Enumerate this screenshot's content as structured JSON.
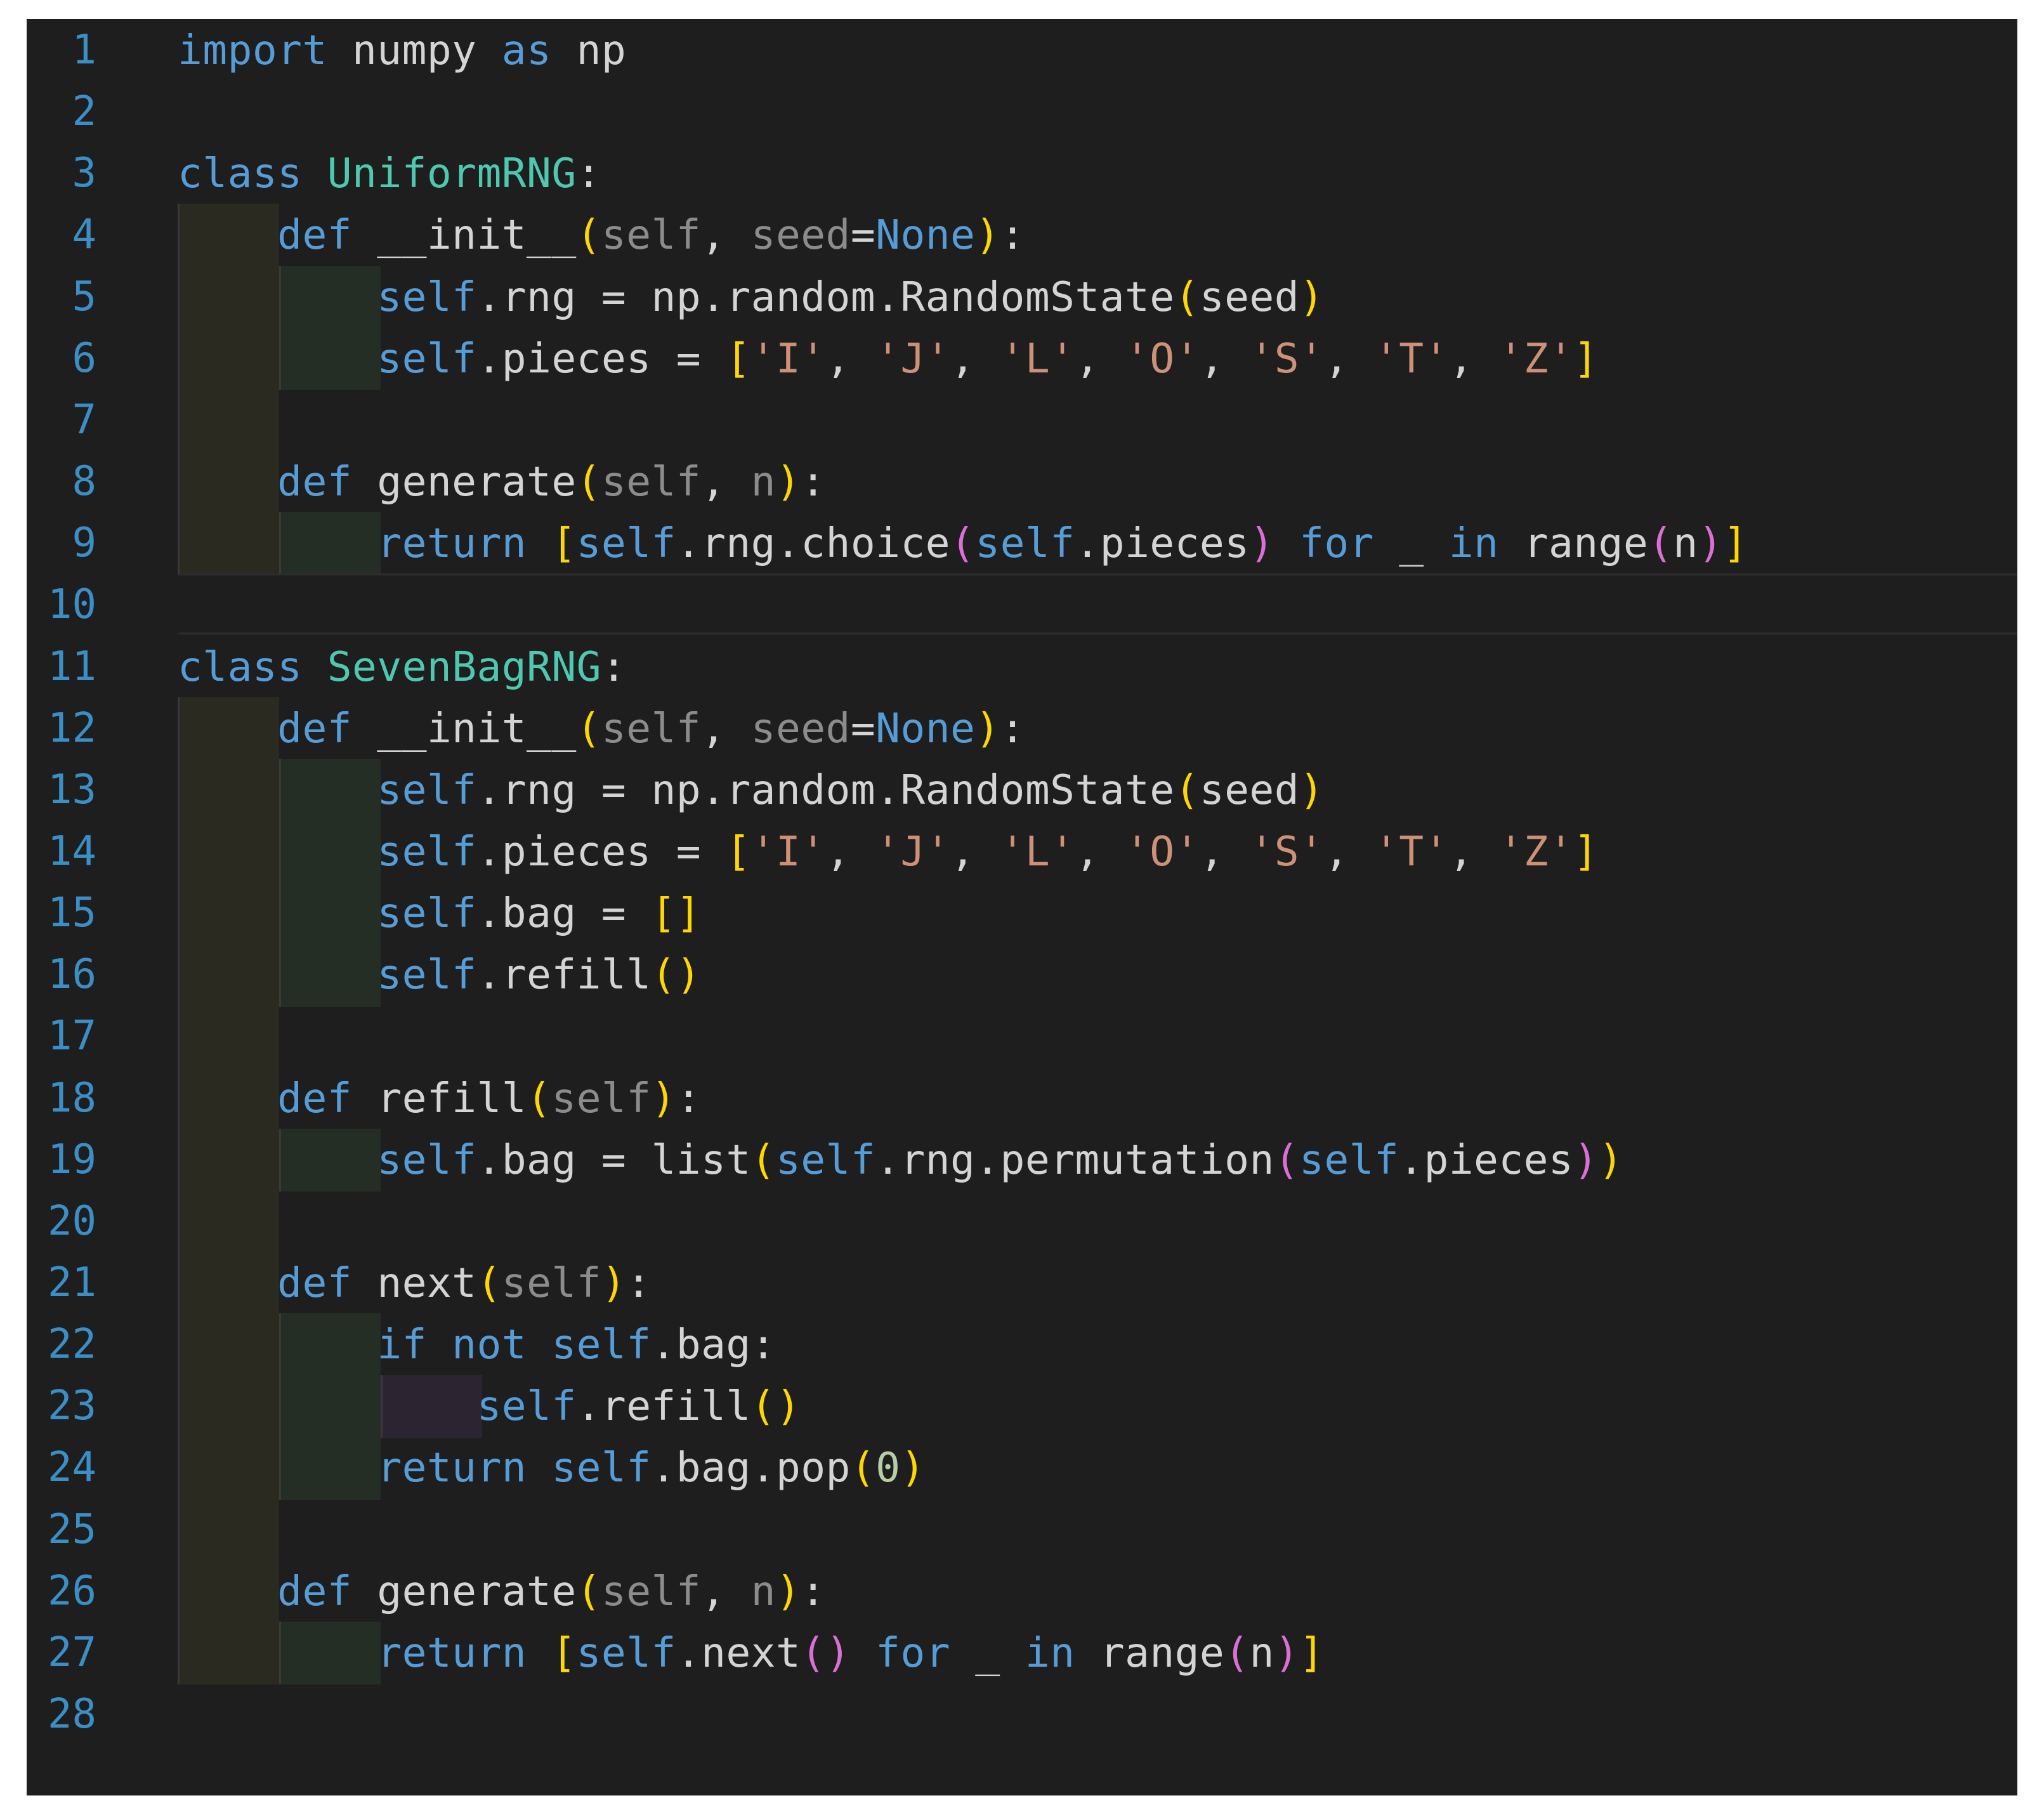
{
  "editor": {
    "line_numbers": [
      "1",
      "2",
      "3",
      "4",
      "5",
      "6",
      "7",
      "8",
      "9",
      "10",
      "11",
      "12",
      "13",
      "14",
      "15",
      "16",
      "17",
      "18",
      "19",
      "20",
      "21",
      "22",
      "23",
      "24",
      "25",
      "26",
      "27",
      "28"
    ],
    "lines": [
      [
        [
          "kw",
          "import"
        ],
        [
          "plain",
          " numpy "
        ],
        [
          "kw",
          "as"
        ],
        [
          "plain",
          " np"
        ]
      ],
      [],
      [
        [
          "kw",
          "class"
        ],
        [
          "plain",
          " "
        ],
        [
          "cls",
          "UniformRNG"
        ],
        [
          "plain",
          ":"
        ]
      ],
      [
        [
          "plain",
          "    "
        ],
        [
          "kw",
          "def"
        ],
        [
          "plain",
          " __init__"
        ],
        [
          "b1",
          "("
        ],
        [
          "prm",
          "self"
        ],
        [
          "plain",
          ", "
        ],
        [
          "prm",
          "seed"
        ],
        [
          "plain",
          "="
        ],
        [
          "kw",
          "None"
        ],
        [
          "b1",
          ")"
        ],
        [
          "plain",
          ":"
        ]
      ],
      [
        [
          "plain",
          "        "
        ],
        [
          "self",
          "self"
        ],
        [
          "plain",
          ".rng = np.random.RandomState"
        ],
        [
          "b1",
          "("
        ],
        [
          "plain",
          "seed"
        ],
        [
          "b1",
          ")"
        ]
      ],
      [
        [
          "plain",
          "        "
        ],
        [
          "self",
          "self"
        ],
        [
          "plain",
          ".pieces = "
        ],
        [
          "b1",
          "["
        ],
        [
          "str",
          "'I'"
        ],
        [
          "plain",
          ", "
        ],
        [
          "str",
          "'J'"
        ],
        [
          "plain",
          ", "
        ],
        [
          "str",
          "'L'"
        ],
        [
          "plain",
          ", "
        ],
        [
          "str",
          "'O'"
        ],
        [
          "plain",
          ", "
        ],
        [
          "str",
          "'S'"
        ],
        [
          "plain",
          ", "
        ],
        [
          "str",
          "'T'"
        ],
        [
          "plain",
          ", "
        ],
        [
          "str",
          "'Z'"
        ],
        [
          "b1",
          "]"
        ]
      ],
      [],
      [
        [
          "plain",
          "    "
        ],
        [
          "kw",
          "def"
        ],
        [
          "plain",
          " generate"
        ],
        [
          "b1",
          "("
        ],
        [
          "prm",
          "self"
        ],
        [
          "plain",
          ", "
        ],
        [
          "prm",
          "n"
        ],
        [
          "b1",
          ")"
        ],
        [
          "plain",
          ":"
        ]
      ],
      [
        [
          "plain",
          "        "
        ],
        [
          "ctl",
          "return"
        ],
        [
          "plain",
          " "
        ],
        [
          "b1",
          "["
        ],
        [
          "self",
          "self"
        ],
        [
          "plain",
          ".rng.choice"
        ],
        [
          "b2",
          "("
        ],
        [
          "self",
          "self"
        ],
        [
          "plain",
          ".pieces"
        ],
        [
          "b2",
          ")"
        ],
        [
          "plain",
          " "
        ],
        [
          "ctl",
          "for"
        ],
        [
          "plain",
          " _ "
        ],
        [
          "ctl",
          "in"
        ],
        [
          "plain",
          " range"
        ],
        [
          "b2",
          "("
        ],
        [
          "plain",
          "n"
        ],
        [
          "b2",
          ")"
        ],
        [
          "b1",
          "]"
        ]
      ],
      [],
      [
        [
          "kw",
          "class"
        ],
        [
          "plain",
          " "
        ],
        [
          "cls",
          "SevenBagRNG"
        ],
        [
          "plain",
          ":"
        ]
      ],
      [
        [
          "plain",
          "    "
        ],
        [
          "kw",
          "def"
        ],
        [
          "plain",
          " __init__"
        ],
        [
          "b1",
          "("
        ],
        [
          "prm",
          "self"
        ],
        [
          "plain",
          ", "
        ],
        [
          "prm",
          "seed"
        ],
        [
          "plain",
          "="
        ],
        [
          "kw",
          "None"
        ],
        [
          "b1",
          ")"
        ],
        [
          "plain",
          ":"
        ]
      ],
      [
        [
          "plain",
          "        "
        ],
        [
          "self",
          "self"
        ],
        [
          "plain",
          ".rng = np.random.RandomState"
        ],
        [
          "b1",
          "("
        ],
        [
          "plain",
          "seed"
        ],
        [
          "b1",
          ")"
        ]
      ],
      [
        [
          "plain",
          "        "
        ],
        [
          "self",
          "self"
        ],
        [
          "plain",
          ".pieces = "
        ],
        [
          "b1",
          "["
        ],
        [
          "str",
          "'I'"
        ],
        [
          "plain",
          ", "
        ],
        [
          "str",
          "'J'"
        ],
        [
          "plain",
          ", "
        ],
        [
          "str",
          "'L'"
        ],
        [
          "plain",
          ", "
        ],
        [
          "str",
          "'O'"
        ],
        [
          "plain",
          ", "
        ],
        [
          "str",
          "'S'"
        ],
        [
          "plain",
          ", "
        ],
        [
          "str",
          "'T'"
        ],
        [
          "plain",
          ", "
        ],
        [
          "str",
          "'Z'"
        ],
        [
          "b1",
          "]"
        ]
      ],
      [
        [
          "plain",
          "        "
        ],
        [
          "self",
          "self"
        ],
        [
          "plain",
          ".bag = "
        ],
        [
          "b1",
          "[]"
        ]
      ],
      [
        [
          "plain",
          "        "
        ],
        [
          "self",
          "self"
        ],
        [
          "plain",
          ".refill"
        ],
        [
          "b1",
          "()"
        ]
      ],
      [],
      [
        [
          "plain",
          "    "
        ],
        [
          "kw",
          "def"
        ],
        [
          "plain",
          " refill"
        ],
        [
          "b1",
          "("
        ],
        [
          "prm",
          "self"
        ],
        [
          "b1",
          ")"
        ],
        [
          "plain",
          ":"
        ]
      ],
      [
        [
          "plain",
          "        "
        ],
        [
          "self",
          "self"
        ],
        [
          "plain",
          ".bag = list"
        ],
        [
          "b1",
          "("
        ],
        [
          "self",
          "self"
        ],
        [
          "plain",
          ".rng.permutation"
        ],
        [
          "b2",
          "("
        ],
        [
          "self",
          "self"
        ],
        [
          "plain",
          ".pieces"
        ],
        [
          "b2",
          ")"
        ],
        [
          "b1",
          ")"
        ]
      ],
      [],
      [
        [
          "plain",
          "    "
        ],
        [
          "kw",
          "def"
        ],
        [
          "plain",
          " next"
        ],
        [
          "b1",
          "("
        ],
        [
          "prm",
          "self"
        ],
        [
          "b1",
          ")"
        ],
        [
          "plain",
          ":"
        ]
      ],
      [
        [
          "plain",
          "        "
        ],
        [
          "ctl",
          "if"
        ],
        [
          "plain",
          " "
        ],
        [
          "ctl",
          "not"
        ],
        [
          "plain",
          " "
        ],
        [
          "self",
          "self"
        ],
        [
          "plain",
          ".bag:"
        ]
      ],
      [
        [
          "plain",
          "            "
        ],
        [
          "self",
          "self"
        ],
        [
          "plain",
          ".refill"
        ],
        [
          "b1",
          "()"
        ]
      ],
      [
        [
          "plain",
          "        "
        ],
        [
          "ctl",
          "return"
        ],
        [
          "plain",
          " "
        ],
        [
          "self",
          "self"
        ],
        [
          "plain",
          ".bag.pop"
        ],
        [
          "b1",
          "("
        ],
        [
          "num",
          "0"
        ],
        [
          "b1",
          ")"
        ]
      ],
      [],
      [
        [
          "plain",
          "    "
        ],
        [
          "kw",
          "def"
        ],
        [
          "plain",
          " generate"
        ],
        [
          "b1",
          "("
        ],
        [
          "prm",
          "self"
        ],
        [
          "plain",
          ", "
        ],
        [
          "prm",
          "n"
        ],
        [
          "b1",
          ")"
        ],
        [
          "plain",
          ":"
        ]
      ],
      [
        [
          "plain",
          "        "
        ],
        [
          "ctl",
          "return"
        ],
        [
          "plain",
          " "
        ],
        [
          "b1",
          "["
        ],
        [
          "self",
          "self"
        ],
        [
          "plain",
          ".next"
        ],
        [
          "b2",
          "()"
        ],
        [
          "plain",
          " "
        ],
        [
          "ctl",
          "for"
        ],
        [
          "plain",
          " _ "
        ],
        [
          "ctl",
          "in"
        ],
        [
          "plain",
          " range"
        ],
        [
          "b2",
          "("
        ],
        [
          "plain",
          "n"
        ],
        [
          "b2",
          ")"
        ],
        [
          "b1",
          "]"
        ]
      ],
      []
    ],
    "current_line": 10,
    "colors": {
      "background": "#1e1e1e",
      "line_number": "#3b8fc7",
      "keyword": "#569cd6",
      "class_name": "#4ec9b0",
      "string": "#ce9178",
      "bracket_level1": "#ffd700",
      "bracket_level2": "#da70d6",
      "parameter": "#8c8c8c"
    }
  }
}
